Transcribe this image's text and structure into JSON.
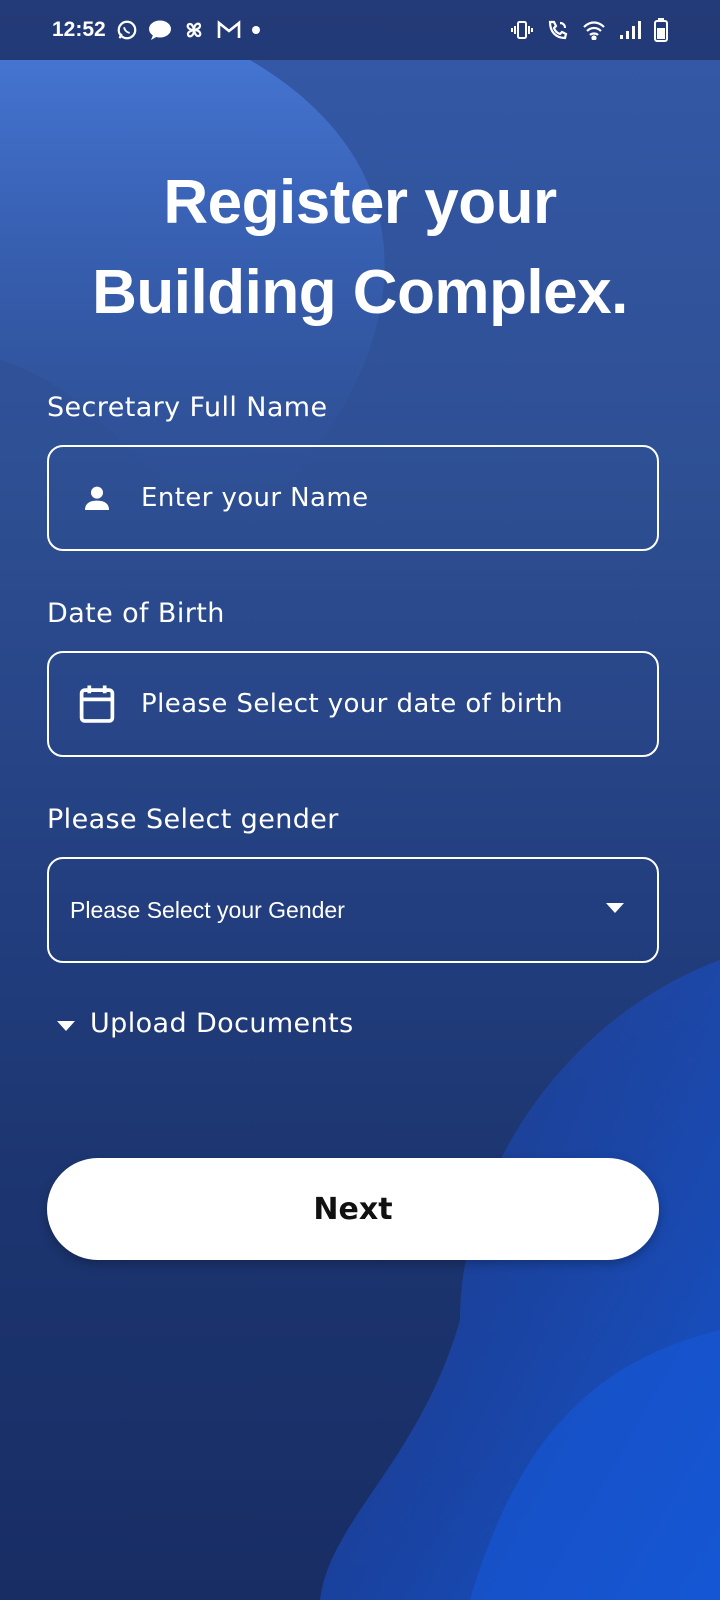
{
  "status_bar": {
    "time": "12:52",
    "left_icons": [
      "whatsapp-icon",
      "chat-bubble-icon",
      "fan-icon",
      "gmail-icon",
      "notification-dot-icon"
    ],
    "right_icons": [
      "vibrate-icon",
      "wifi-call-icon",
      "wifi-icon",
      "cell-signal-icon",
      "battery-icon"
    ]
  },
  "title": {
    "line1": "Register your",
    "line2": "Building Complex."
  },
  "form": {
    "name": {
      "label": "Secretary Full Name",
      "placeholder": "Enter your Name",
      "icon": "person-icon"
    },
    "dob": {
      "label": "Date of Birth",
      "placeholder": "Please Select your date of birth",
      "icon": "calendar-icon"
    },
    "gender": {
      "label": "Please Select gender",
      "placeholder": "Please Select your Gender",
      "icon": "dropdown-caret-icon"
    },
    "upload": {
      "label": "Upload Documents",
      "icon": "expand-caret-icon"
    }
  },
  "actions": {
    "next_label": "Next"
  },
  "colors": {
    "background_top": "#3559a8",
    "background_bottom": "#182d64",
    "accent_wave": "#1f4fc2",
    "button_bg": "#ffffff",
    "button_text": "#111111"
  }
}
